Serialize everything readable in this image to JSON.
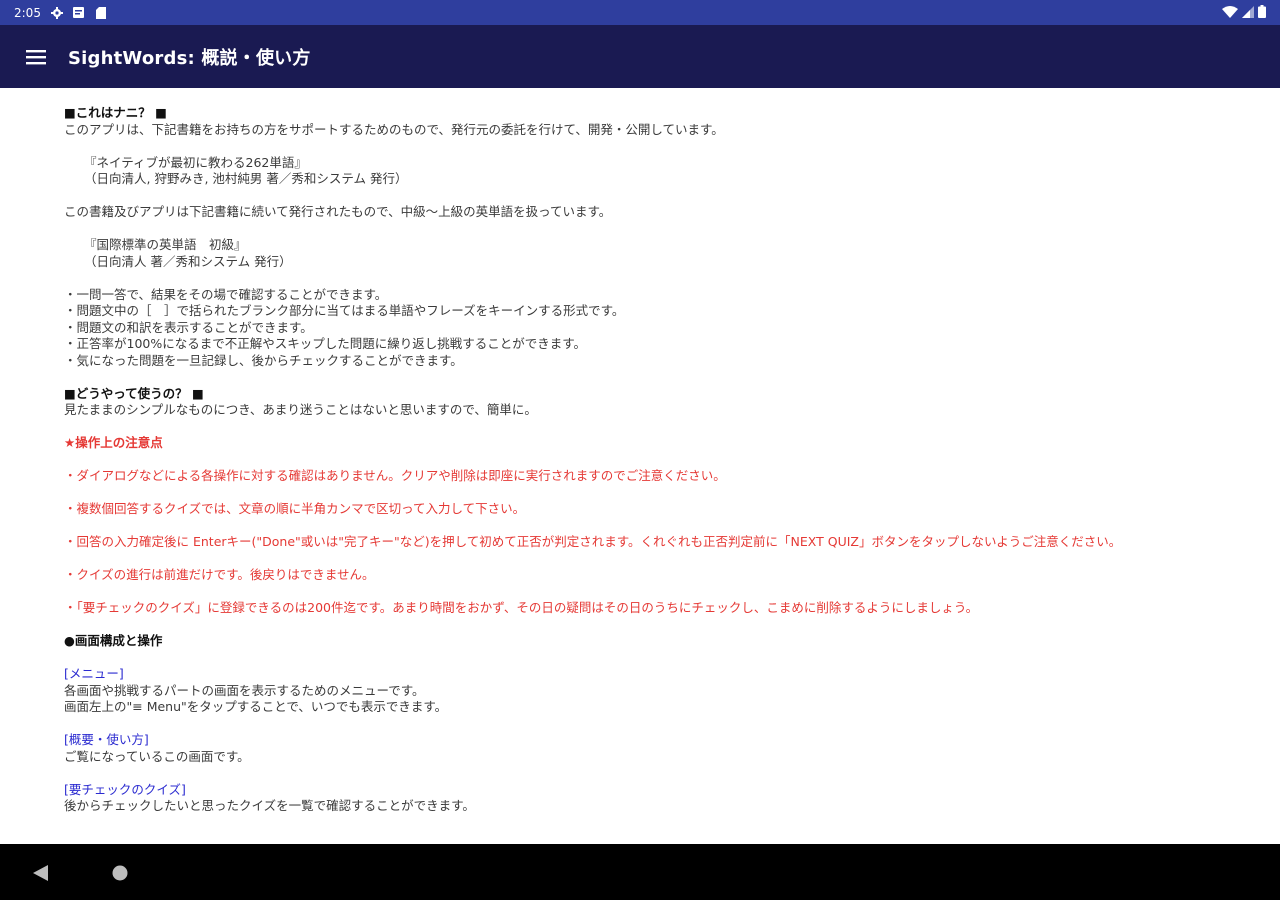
{
  "status_bar": {
    "time": "2:05",
    "icons": [
      "gear-icon",
      "notification-icon",
      "sd-card-icon",
      "wifi-icon",
      "signal-icon",
      "battery-icon"
    ]
  },
  "app_bar": {
    "title": "SightWords: 概説・使い方",
    "menu_icon": "hamburger-menu-icon"
  },
  "content": {
    "section1_heading": "■これはナニ？ ■",
    "section1_intro": "このアプリは、下記書籍をお持ちの方をサポートするためのもので、発行元の委託を行けて、開発・公開しています。",
    "book1_title": "『ネイティブが最初に教わる262単語』",
    "book1_authors": "（日向清人, 狩野みき, 池村純男 著／秀和システム 発行）",
    "section1_mid": "この書籍及びアプリは下記書籍に続いて発行されたもので、中級〜上級の英単語を扱っています。",
    "book2_title": "『国際標準の英単語　初級』",
    "book2_authors": "（日向清人 著／秀和システム 発行）",
    "features": [
      "・一問一答で、結果をその場で確認することができます。",
      "・問題文中の［　］で括られたブランク部分に当てはまる単語やフレーズをキーインする形式です。",
      "・問題文の和訳を表示することができます。",
      "・正答率が100%になるまで不正解やスキップした問題に繰り返し挑戦することができます。",
      "・気になった問題を一旦記録し、後からチェックすることができます。"
    ],
    "section2_heading": "■どうやって使うの？ ■",
    "section2_intro": "見たままのシンプルなものにつき、あまり迷うことはないと思いますので、簡単に。",
    "notes_heading": "★操作上の注意点",
    "notes": [
      "・ダイアログなどによる各操作に対する確認はありません。クリアや削除は即座に実行されますのでご注意ください。",
      "・複数個回答するクイズでは、文章の順に半角カンマで区切って入力して下さい。",
      "・回答の入力確定後に Enterキー(\"Done\"或いは\"完了キー\"など)を押して初めて正否が判定されます。くれぐれも正否判定前に「NEXT QUIZ」ボタンをタップしないようご注意ください。",
      "・クイズの進行は前進だけです。後戻りはできません。",
      "・「要チェックのクイズ」に登録できるのは200件迄です。あまり時間をおかず、その日の疑問はその日のうちにチェックし、こまめに削除するようにしましょう。"
    ],
    "screens_heading": "●画面構成と操作",
    "screens": [
      {
        "link": "[メニュー]",
        "desc": [
          "各画面や挑戦するパートの画面を表示するためのメニューです。",
          "画面左上の\"≡ Menu\"をタップすることで、いつでも表示できます。"
        ]
      },
      {
        "link": "[概要・使い方]",
        "desc": [
          "ご覧になっているこの画面です。"
        ]
      },
      {
        "link": "[要チェックのクイズ]",
        "desc": [
          "後からチェックしたいと思ったクイズを一覧で確認することができます。"
        ]
      }
    ]
  },
  "colors": {
    "status_bar": "#2f3e9e",
    "app_bar": "#1a1a52",
    "warning_text": "#e53935",
    "link_text": "#2b2bd0",
    "nav_bar": "#000000"
  },
  "nav_bar": {
    "icons": [
      "back-triangle-icon",
      "home-circle-icon"
    ]
  }
}
